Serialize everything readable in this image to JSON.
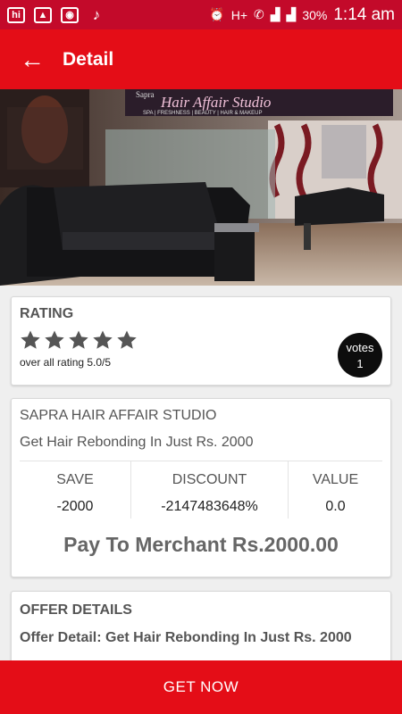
{
  "status_bar": {
    "battery": "30%",
    "time": "1:14 am"
  },
  "app_bar": {
    "title": "Detail"
  },
  "hero": {
    "studio_brand": "Sapra",
    "studio_name": "Hair Affair Studio",
    "studio_services": "SPA | FRESHNESS | BEAUTY | HAIR & MAKEUP"
  },
  "rating": {
    "label": "RATING",
    "stars": 5,
    "text": "over all rating 5.0/5",
    "votes_label": "votes",
    "votes_count": "1"
  },
  "deal": {
    "merchant": "SAPRA HAIR AFFAIR STUDIO",
    "title": "Get Hair Rebonding In Just Rs. 2000",
    "stats": [
      {
        "label": "SAVE",
        "value": "-2000"
      },
      {
        "label": "DISCOUNT",
        "value": "-2147483648%"
      },
      {
        "label": "VALUE",
        "value": "0.0"
      }
    ],
    "pay": "Pay To Merchant Rs.2000.00"
  },
  "offer": {
    "label": "OFFER DETAILS",
    "text": "Offer Detail: Get Hair Rebonding In Just Rs. 2000"
  },
  "cta": {
    "label": "GET NOW"
  },
  "colors": {
    "status_bar": "#c30a2a",
    "app_bar": "#e40d17",
    "star": "#555555",
    "votes_badge": "#0d0d0d"
  }
}
